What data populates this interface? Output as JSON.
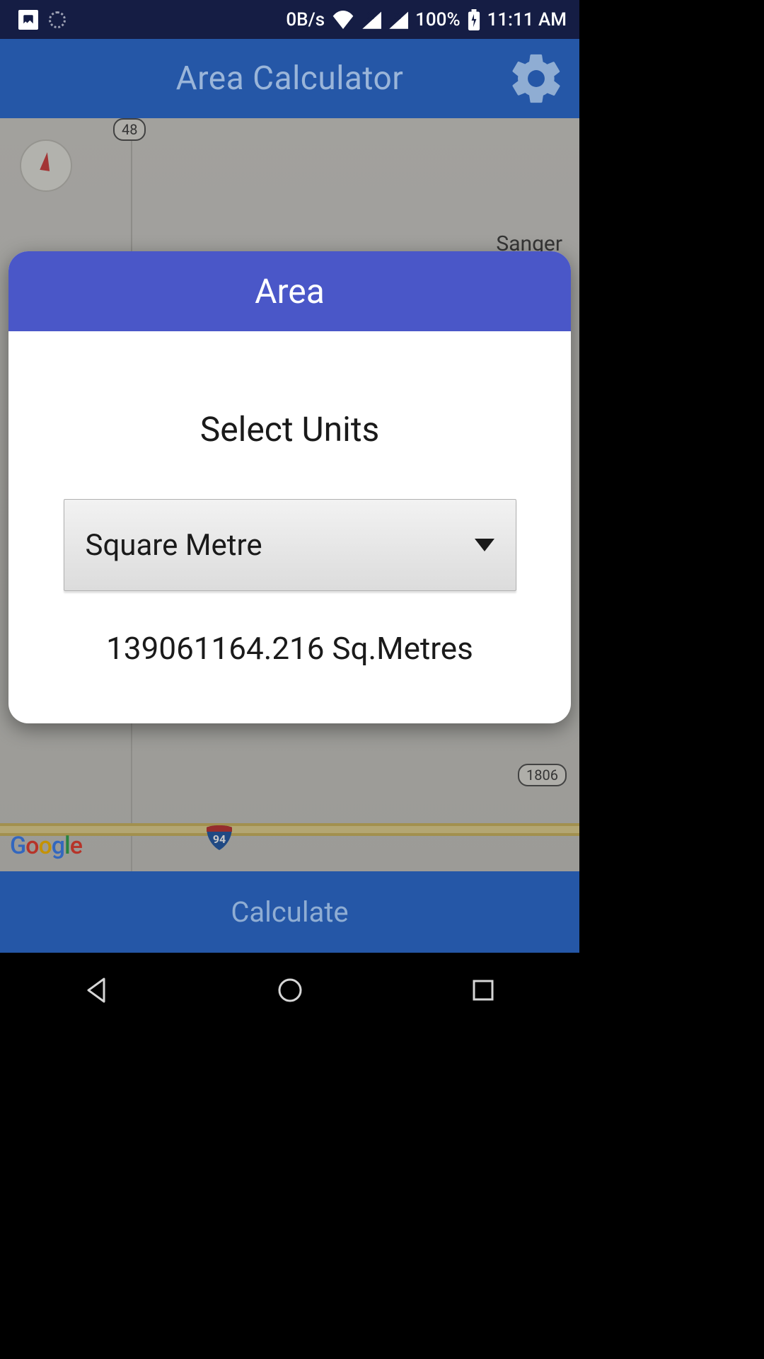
{
  "status": {
    "speed": "0B/s",
    "battery_pct": "100%",
    "time": "11:11 AM"
  },
  "header": {
    "title": "Area Calculator"
  },
  "map": {
    "route_48": "48",
    "route_1806": "1806",
    "city_label": "Sanger",
    "interstate": "94",
    "attribution": "Google"
  },
  "calculate_button_label": "Calculate",
  "dialog": {
    "title": "Area",
    "select_label": "Select Units",
    "selected_unit": "Square Metre",
    "result": "139061164.216 Sq.Metres"
  }
}
